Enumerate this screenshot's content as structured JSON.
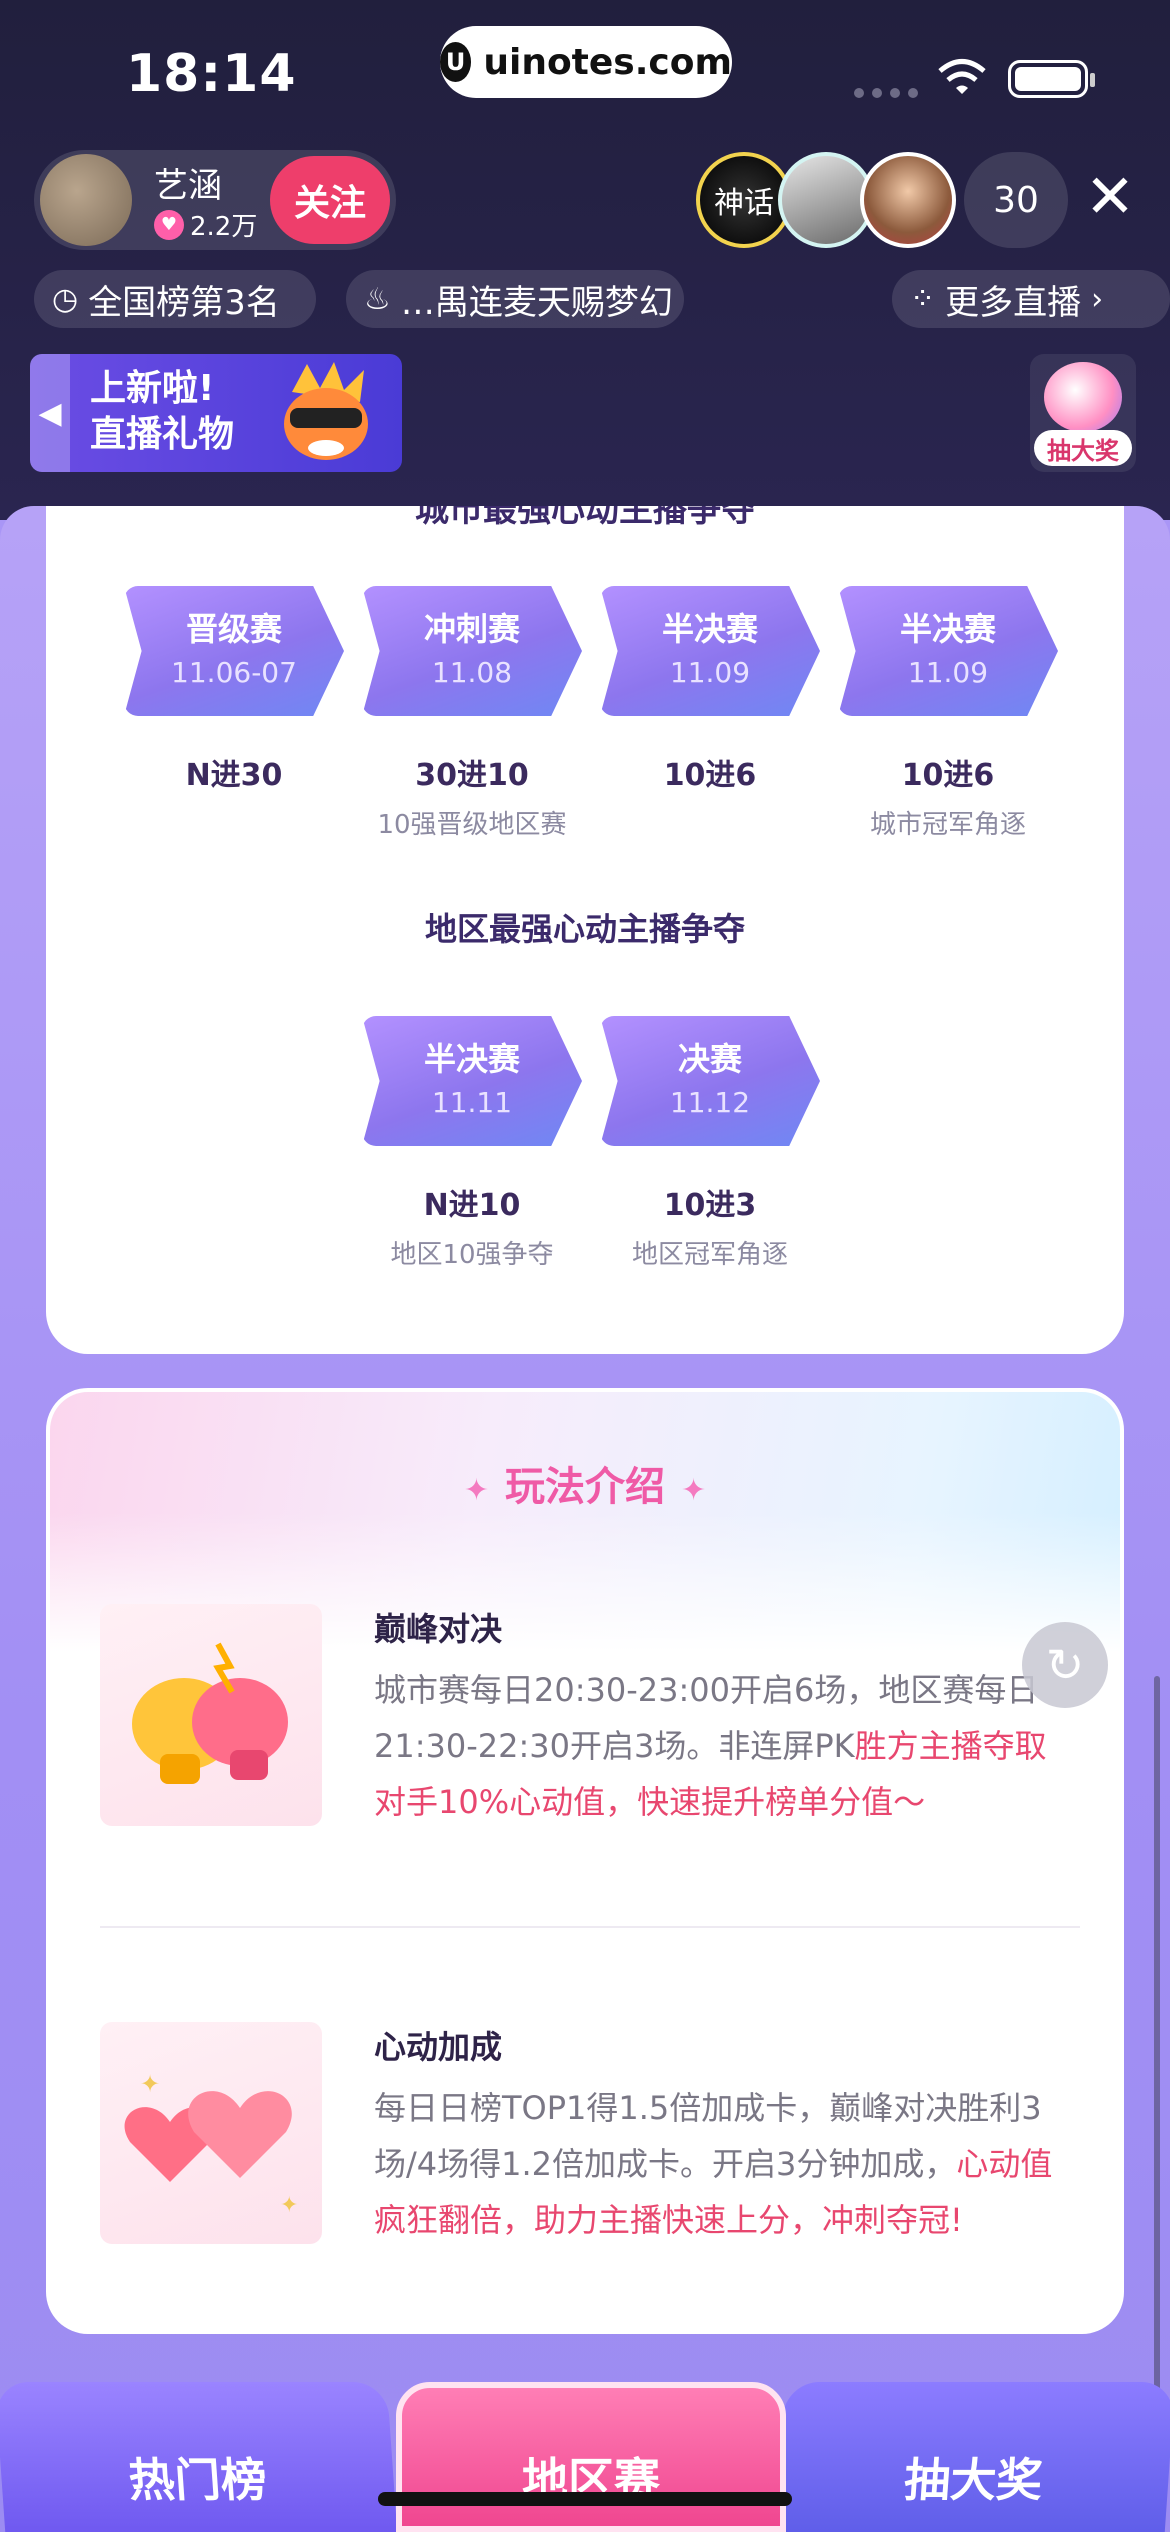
{
  "status": {
    "time": "18:14",
    "url": "uinotes.com"
  },
  "host": {
    "name": "艺涵",
    "fans": "2.2万",
    "follow_label": "关注"
  },
  "viewers": {
    "count": "30",
    "first_badge": "神话"
  },
  "chips": {
    "rank": "全国榜第3名",
    "lianmai": "…禺连麦天赐梦幻",
    "more": "更多直播"
  },
  "promo": {
    "line1": "上新啦!",
    "line2": "直播礼物"
  },
  "lottery_badge": "抽大奖",
  "schedule": {
    "cut_title": "城市最强心动主播争夺",
    "city_stages": [
      {
        "name": "晋级赛",
        "date": "11.06-07",
        "result": "N进30",
        "sub": ""
      },
      {
        "name": "冲刺赛",
        "date": "11.08",
        "result": "30进10",
        "sub": "10强晋级地区赛"
      },
      {
        "name": "半决赛",
        "date": "11.09",
        "result": "10进6",
        "sub": ""
      },
      {
        "name": "半决赛",
        "date": "11.09",
        "result": "10进6",
        "sub": "城市冠军角逐"
      }
    ],
    "region_title": "地区最强心动主播争夺",
    "region_stages": [
      {
        "name": "半决赛",
        "date": "11.11",
        "result": "N进10",
        "sub": "地区10强争夺"
      },
      {
        "name": "决赛",
        "date": "11.12",
        "result": "10进3",
        "sub": "地区冠军角逐"
      }
    ]
  },
  "rules": {
    "title": "玩法介绍",
    "items": [
      {
        "name": "巅峰对决",
        "desc_plain": "城市赛每日20:30-23:00开启6场，地区赛每日21:30-22:30开启3场。非连屏PK",
        "desc_highlight": "胜方主播夺取对手10%心动值，快速提升榜单分值～"
      },
      {
        "name": "心动加成",
        "desc_plain": "每日日榜TOP1得1.5倍加成卡，巅峰对决胜利3场/4场得1.2倍加成卡。开启3分钟加成，",
        "desc_highlight": "心动值疯狂翻倍，助力主播快速上分，冲刺夺冠!"
      }
    ]
  },
  "tabs": [
    {
      "label": "热门榜"
    },
    {
      "label": "地区赛"
    },
    {
      "label": "抽大奖"
    }
  ],
  "colors": {
    "accent_pink": "#e8476f",
    "bg_purple": "#a996f6",
    "follow_red": "#ee3e6b"
  }
}
